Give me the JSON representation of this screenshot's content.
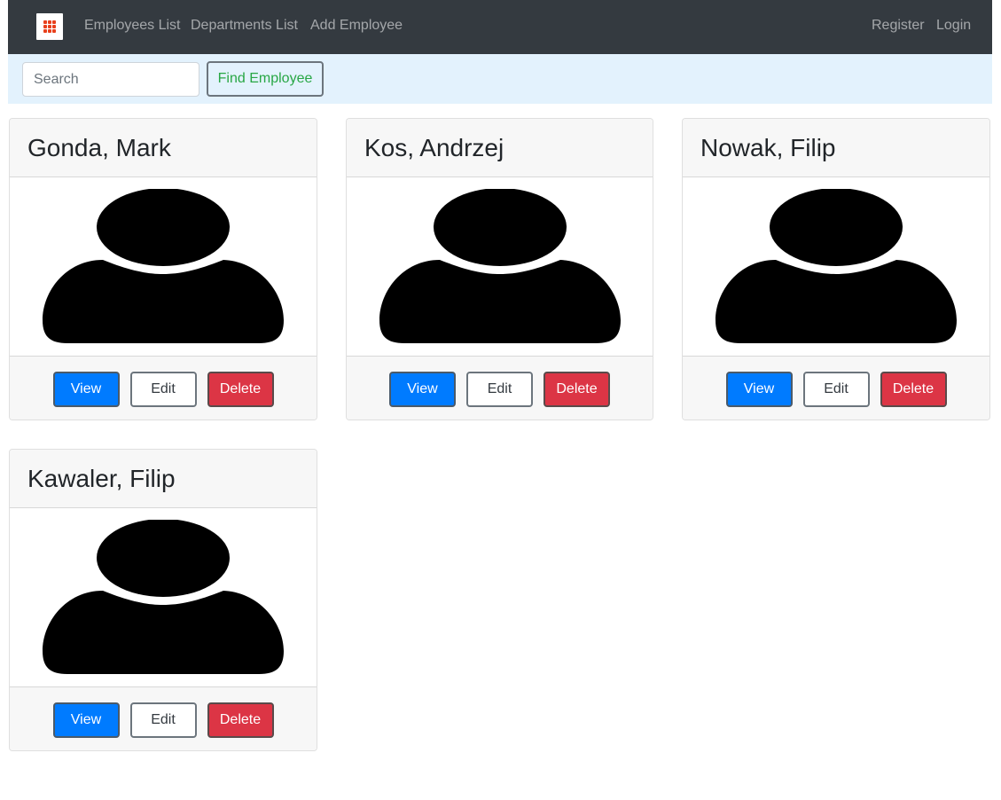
{
  "navbar": {
    "logo_icon": "grid-logo-icon",
    "links": [
      "Employees List",
      "Departments List",
      "Add Employee"
    ],
    "right_links": [
      "Register",
      "Login"
    ]
  },
  "search": {
    "placeholder": "Search",
    "value": "",
    "button_label": "Find Employee"
  },
  "employees": [
    {
      "name": "Gonda, Mark",
      "avatar_icon": "person-silhouette-icon",
      "buttons": {
        "view": "View",
        "edit": "Edit",
        "delete": "Delete"
      }
    },
    {
      "name": "Kos, Andrzej",
      "avatar_icon": "person-silhouette-icon",
      "buttons": {
        "view": "View",
        "edit": "Edit",
        "delete": "Delete"
      }
    },
    {
      "name": "Nowak, Filip",
      "avatar_icon": "person-silhouette-icon",
      "buttons": {
        "view": "View",
        "edit": "Edit",
        "delete": "Delete"
      }
    },
    {
      "name": "Kawaler, Filip",
      "avatar_icon": "person-silhouette-icon",
      "buttons": {
        "view": "View",
        "edit": "Edit",
        "delete": "Delete"
      }
    }
  ],
  "colors": {
    "navbar_bg": "#343a40",
    "searchbar_bg": "#e3f2fd",
    "primary": "#007bff",
    "danger": "#dc3545",
    "success_text": "#28a745",
    "logo_accent": "#e8401c"
  }
}
